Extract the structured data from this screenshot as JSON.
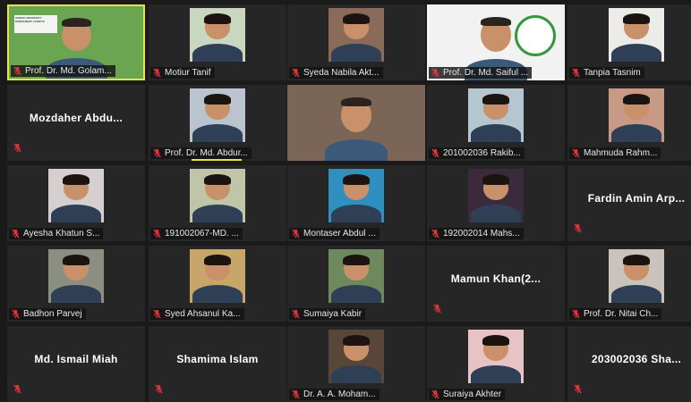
{
  "participants": [
    {
      "id": "p1",
      "label": "Prof. Dr. Md. Golam...",
      "kind": "video-wide",
      "active": true,
      "bg": "#6aa651",
      "sign": "GREEN UNIVERSITY PERMANENT CAMPUS"
    },
    {
      "id": "p2",
      "label": "Motiur Tanif",
      "kind": "photo",
      "bg": "#c9d7c1"
    },
    {
      "id": "p3",
      "label": "Syeda Nabila Akt...",
      "kind": "photo",
      "bg": "#8a6a58"
    },
    {
      "id": "p4",
      "label": "Prof. Dr. Md. Saiful ...",
      "kind": "video-wide",
      "bg": "#f2f2f2",
      "logo": true
    },
    {
      "id": "p5",
      "label": "Tanpia Tasnim",
      "kind": "photo",
      "bg": "#ecebe8"
    },
    {
      "id": "p6",
      "label": "Mozdaher Abdu...",
      "kind": "name"
    },
    {
      "id": "p7",
      "label": "Prof. Dr. Md. Abdur...",
      "kind": "photo",
      "bg": "#b9c4cf",
      "speaking": true
    },
    {
      "id": "p8",
      "label": "",
      "kind": "video-wide",
      "bg": "#7b6557"
    },
    {
      "id": "p9",
      "label": "201002036 Rakib...",
      "kind": "photo",
      "bg": "#b5c6d0"
    },
    {
      "id": "p10",
      "label": "Mahmuda Rahm...",
      "kind": "photo",
      "bg": "#c89a86"
    },
    {
      "id": "p11",
      "label": "Ayesha Khatun S...",
      "kind": "photo",
      "bg": "#d6cfd0"
    },
    {
      "id": "p12",
      "label": "191002067-MD. ...",
      "kind": "photo",
      "bg": "#bfc6a8"
    },
    {
      "id": "p13",
      "label": "Montaser Abdul ...",
      "kind": "photo",
      "bg": "#2f8fbf"
    },
    {
      "id": "p14",
      "label": "192002014 Mahs...",
      "kind": "photo",
      "bg": "#3a2a3c"
    },
    {
      "id": "p15",
      "label": "Fardin Amin Arp...",
      "kind": "name"
    },
    {
      "id": "p16",
      "label": "Badhon Parvej",
      "kind": "photo",
      "bg": "#8a8f82"
    },
    {
      "id": "p17",
      "label": "Syed Ahsanul Ka...",
      "kind": "photo",
      "bg": "#c8a66a"
    },
    {
      "id": "p18",
      "label": "Sumaiya Kabir",
      "kind": "photo",
      "bg": "#6c8a5e"
    },
    {
      "id": "p19",
      "label": "Mamun Khan(2...",
      "kind": "name"
    },
    {
      "id": "p20",
      "label": "Prof. Dr. Nitai Ch...",
      "kind": "photo",
      "bg": "#c9c3bb"
    },
    {
      "id": "p21",
      "label": "Md. Ismail Miah",
      "kind": "name"
    },
    {
      "id": "p22",
      "label": "Shamima Islam",
      "kind": "name"
    },
    {
      "id": "p23",
      "label": "Dr. A. A. Moham...",
      "kind": "photo",
      "bg": "#5a4636"
    },
    {
      "id": "p24",
      "label": "Suraiya Akhter",
      "kind": "photo",
      "bg": "#e8c3c6"
    },
    {
      "id": "p25",
      "label": "203002036 Sha...",
      "kind": "name"
    }
  ],
  "colors": {
    "background": "#1a1a1a",
    "tile": "#262626",
    "active_border": "#e7e34a",
    "mic_muted": "#e0343c"
  }
}
